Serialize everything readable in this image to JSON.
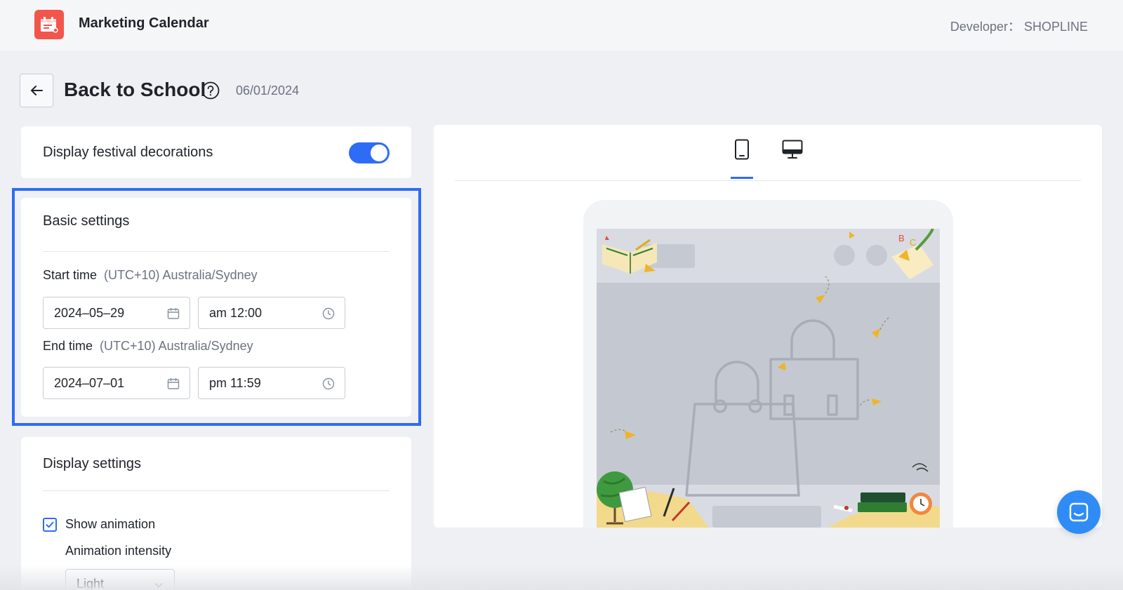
{
  "header": {
    "app_title": "Marketing Calendar",
    "developer": "Developer： SHOPLINE",
    "logo_icon": "calendar-icon",
    "brand_color": "#f2554c"
  },
  "page": {
    "title": "Back to School",
    "date": "06/01/2024"
  },
  "festival": {
    "label": "Display festival decorations",
    "enabled": true
  },
  "basic_settings": {
    "title": "Basic settings",
    "start_label": "Start time",
    "start_timezone": "(UTC+10) Australia/Sydney",
    "start_date": "2024–05–29",
    "start_time": "am 12:00",
    "end_label": "End time",
    "end_timezone": "(UTC+10) Australia/Sydney",
    "end_date": "2024–07–01",
    "end_time": "pm 11:59"
  },
  "display_settings": {
    "title": "Display settings",
    "show_animation_label": "Show animation",
    "show_animation_checked": true,
    "intensity_label": "Animation intensity",
    "intensity_value": "Light"
  },
  "preview": {
    "tabs": [
      "mobile",
      "desktop"
    ],
    "active_tab": "mobile"
  },
  "colors": {
    "accent": "#2f6cf6",
    "chat": "#2f8cf6"
  }
}
